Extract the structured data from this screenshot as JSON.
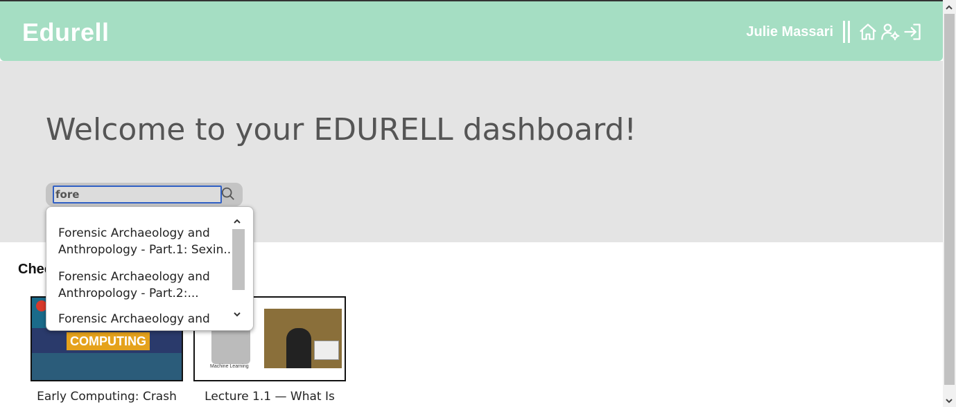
{
  "header": {
    "brand": "Edurell",
    "user_name": "Julie Massari",
    "icons": [
      "home-icon",
      "user-settings-icon",
      "logout-icon"
    ]
  },
  "hero": {
    "welcome": "Welcome to your EDURELL dashboard!"
  },
  "search": {
    "value": "fore",
    "placeholder": ""
  },
  "dropdown": {
    "items": [
      {
        "line1": "Forensic Archaeology and",
        "line2": "Anthropology - Part.1: Sexin..."
      },
      {
        "line1": "Forensic Archaeology and",
        "line2": "Anthropology - Part.2:..."
      },
      {
        "line1": "Forensic Archaeology and",
        "line2": ""
      }
    ]
  },
  "section": {
    "title": "Chec"
  },
  "cards": [
    {
      "title": "Early Computing: Crash",
      "thumb_text": "COMPUTING"
    },
    {
      "title": "Lecture 1.1 — What Is",
      "thumb_text": "Machine Learning"
    }
  ],
  "colors": {
    "navbar": "#a5dec3",
    "hero_bg": "#e4e4e4",
    "focus_outline": "#2f5fc4"
  }
}
